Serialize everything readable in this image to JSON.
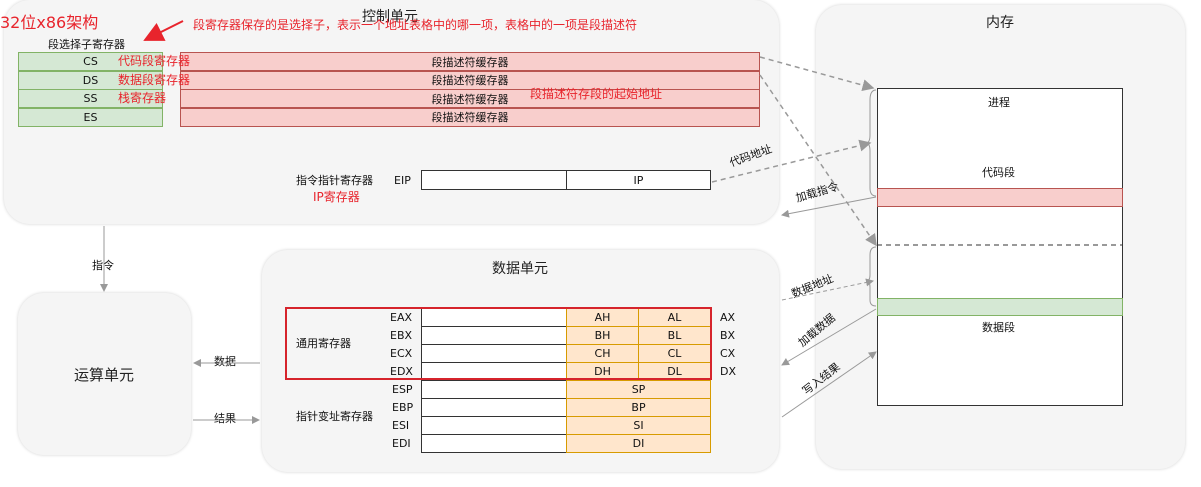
{
  "title": "32位x86架构",
  "annotation": "段寄存器保存的是选择子，表示一个地址表格中的哪一项，表格中的一项是段描述符",
  "control_unit": {
    "title": "控制单元",
    "selector_label": "段选择子寄存器",
    "segment_registers": [
      {
        "name": "CS",
        "note": "代码段寄存器",
        "descriptor": "段描述符缓存器"
      },
      {
        "name": "DS",
        "note": "数据段寄存器",
        "descriptor": "段描述符缓存器"
      },
      {
        "name": "SS",
        "note": "栈寄存器",
        "descriptor": "段描述符缓存器"
      },
      {
        "name": "ES",
        "note": "",
        "descriptor": "段描述符缓存器"
      }
    ],
    "descriptor_note": "段描述符存段的起始地址",
    "eip_label": "指令指针寄存器",
    "eip_name": "EIP",
    "ip": "IP",
    "ip_note": "IP寄存器"
  },
  "memory": {
    "title": "内存",
    "process": "进程",
    "code_segment": "代码段",
    "data_segment": "数据段"
  },
  "data_unit": {
    "title": "数据单元",
    "general_label": "通用寄存器",
    "general": [
      {
        "name": "EAX",
        "hi": "AH",
        "lo": "AL",
        "x": "AX"
      },
      {
        "name": "EBX",
        "hi": "BH",
        "lo": "BL",
        "x": "BX"
      },
      {
        "name": "ECX",
        "hi": "CH",
        "lo": "CL",
        "x": "CX"
      },
      {
        "name": "EDX",
        "hi": "DH",
        "lo": "DL",
        "x": "DX"
      }
    ],
    "pointer_label": "指针变址寄存器",
    "pointer": [
      {
        "name": "ESP",
        "low": "SP"
      },
      {
        "name": "EBP",
        "low": "BP"
      },
      {
        "name": "ESI",
        "low": "SI"
      },
      {
        "name": "EDI",
        "low": "DI"
      }
    ]
  },
  "alu": {
    "title": "运算单元"
  },
  "arrows": {
    "instruction": "指令",
    "data": "数据",
    "result": "结果",
    "code_address": "代码地址",
    "load_instruction": "加载指令",
    "data_address": "数据地址",
    "load_data": "加载数据",
    "write_result": "写入结果"
  },
  "colors": {
    "segment_green": "#d5e8d4",
    "descriptor_pink": "#f8cecc",
    "register_orange": "#ffe6cc",
    "annotation_red": "#e8242c"
  }
}
